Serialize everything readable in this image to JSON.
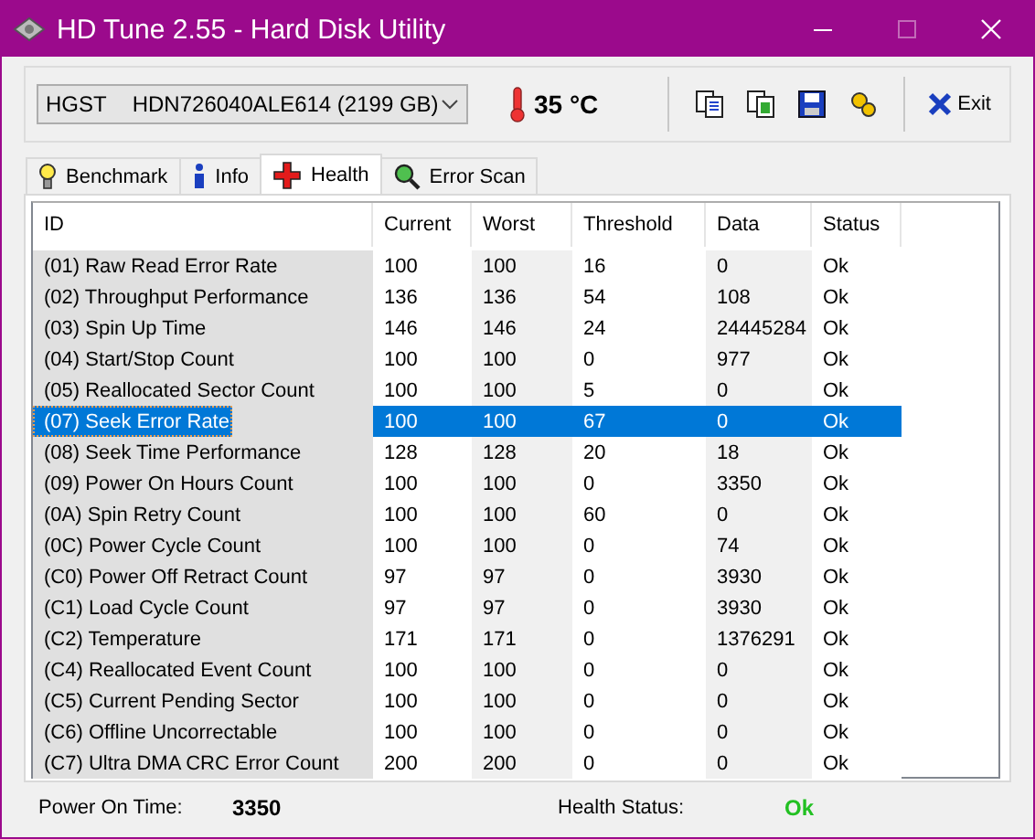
{
  "window": {
    "title": "HD Tune 2.55 - Hard Disk Utility"
  },
  "toolbar": {
    "drive_vendor": "HGST",
    "drive_model": "HDN726040ALE614 (2199 GB)",
    "temperature": "35 °C",
    "exit_label": "Exit"
  },
  "tabs": [
    {
      "label": "Benchmark",
      "selected": false
    },
    {
      "label": "Info",
      "selected": false
    },
    {
      "label": "Health",
      "selected": true
    },
    {
      "label": "Error Scan",
      "selected": false
    }
  ],
  "table": {
    "columns": [
      "ID",
      "Current",
      "Worst",
      "Threshold",
      "Data",
      "Status"
    ],
    "rows": [
      {
        "cells": [
          "(01) Raw Read Error Rate",
          "100",
          "100",
          "16",
          "0",
          "Ok"
        ],
        "selected": false
      },
      {
        "cells": [
          "(02) Throughput Performance",
          "136",
          "136",
          "54",
          "108",
          "Ok"
        ],
        "selected": false
      },
      {
        "cells": [
          "(03) Spin Up Time",
          "146",
          "146",
          "24",
          "24445284",
          "Ok"
        ],
        "selected": false
      },
      {
        "cells": [
          "(04) Start/Stop Count",
          "100",
          "100",
          "0",
          "977",
          "Ok"
        ],
        "selected": false
      },
      {
        "cells": [
          "(05) Reallocated Sector Count",
          "100",
          "100",
          "5",
          "0",
          "Ok"
        ],
        "selected": false
      },
      {
        "cells": [
          "(07) Seek Error Rate",
          "100",
          "100",
          "67",
          "0",
          "Ok"
        ],
        "selected": true
      },
      {
        "cells": [
          "(08) Seek Time Performance",
          "128",
          "128",
          "20",
          "18",
          "Ok"
        ],
        "selected": false
      },
      {
        "cells": [
          "(09) Power On Hours Count",
          "100",
          "100",
          "0",
          "3350",
          "Ok"
        ],
        "selected": false
      },
      {
        "cells": [
          "(0A) Spin Retry Count",
          "100",
          "100",
          "60",
          "0",
          "Ok"
        ],
        "selected": false
      },
      {
        "cells": [
          "(0C) Power Cycle Count",
          "100",
          "100",
          "0",
          "74",
          "Ok"
        ],
        "selected": false
      },
      {
        "cells": [
          "(C0) Power Off Retract Count",
          "97",
          "97",
          "0",
          "3930",
          "Ok"
        ],
        "selected": false
      },
      {
        "cells": [
          "(C1) Load Cycle Count",
          "97",
          "97",
          "0",
          "3930",
          "Ok"
        ],
        "selected": false
      },
      {
        "cells": [
          "(C2) Temperature",
          "171",
          "171",
          "0",
          "1376291",
          "Ok"
        ],
        "selected": false
      },
      {
        "cells": [
          "(C4) Reallocated Event Count",
          "100",
          "100",
          "0",
          "0",
          "Ok"
        ],
        "selected": false
      },
      {
        "cells": [
          "(C5) Current Pending Sector",
          "100",
          "100",
          "0",
          "0",
          "Ok"
        ],
        "selected": false
      },
      {
        "cells": [
          "(C6) Offline Uncorrectable",
          "100",
          "100",
          "0",
          "0",
          "Ok"
        ],
        "selected": false
      },
      {
        "cells": [
          "(C7) Ultra DMA CRC Error Count",
          "200",
          "200",
          "0",
          "0",
          "Ok"
        ],
        "selected": false
      }
    ]
  },
  "footer": {
    "power_on_label": "Power On Time:",
    "power_on_value": "3350",
    "health_label": "Health Status:",
    "health_value": "Ok"
  }
}
